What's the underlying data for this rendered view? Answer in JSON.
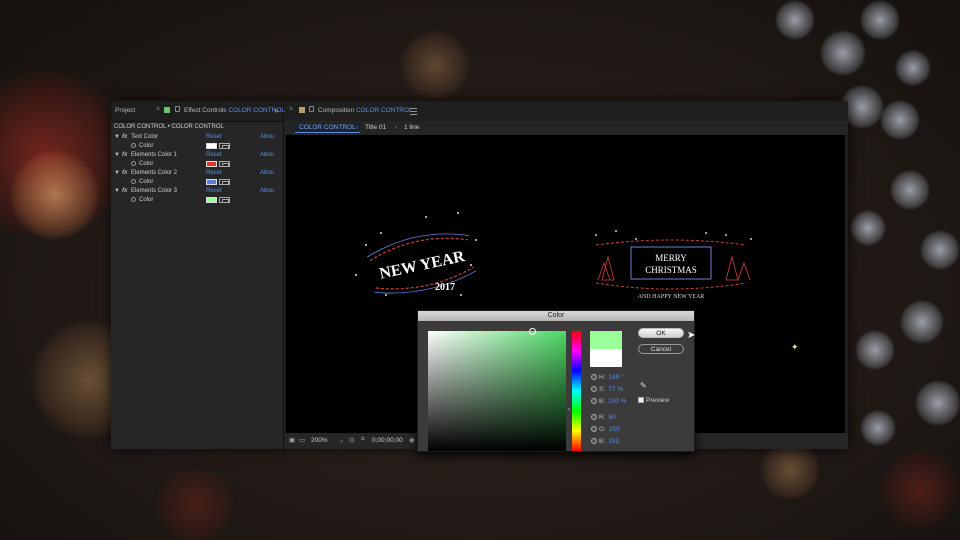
{
  "left_tabs": {
    "project": "Project",
    "effect_controls_prefix": "Effect Controls",
    "effect_controls_name": "COLOR CONTROL"
  },
  "effect_controls": {
    "header": "COLOR CONTROL • COLOR CONTROL",
    "reset": "Reset",
    "about": "Abou",
    "effects": [
      {
        "name": "Text Color",
        "prop": "Color",
        "swatch": "#ffffff"
      },
      {
        "name": "Elements Color 1",
        "prop": "Color",
        "swatch": "#e03030"
      },
      {
        "name": "Elements Color 2",
        "prop": "Color",
        "swatch": "#5f7fd6"
      },
      {
        "name": "Elements Color 3",
        "prop": "Color",
        "swatch": "#99ff99"
      }
    ]
  },
  "composition": {
    "tab_prefix": "Composition",
    "tab_name": "COLOR CONTROL",
    "breadcrumb": [
      "COLOR CONTROL",
      "Title 01",
      "1 line"
    ],
    "zoom": "200%",
    "timecode": "0;00;00;00"
  },
  "scene": {
    "new_year_line1": "NEW YEAR",
    "new_year_line2": "2017",
    "merry_line1": "MERRY",
    "merry_line2": "CHRISTMAS",
    "merry_line3": "AND HAPPY NEW YEAR"
  },
  "color_dialog": {
    "title": "Color",
    "ok": "OK",
    "cancel": "Cancel",
    "fields": [
      {
        "label": "H:",
        "value": "149 °"
      },
      {
        "label": "S:",
        "value": "77 %"
      },
      {
        "label": "B:",
        "value": "100 %"
      },
      {
        "label": "R:",
        "value": "60"
      },
      {
        "label": "G:",
        "value": "255"
      },
      {
        "label": "B:",
        "value": "153"
      }
    ],
    "preview_label": "Preview",
    "new_color": "#99ff99",
    "old_color": "#ffffff"
  },
  "icons": [
    "close-icon",
    "lock-icon",
    "menu-icon",
    "stopwatch-icon",
    "eyedropper-icon",
    "collapse-icon",
    "anchor-point-icon",
    "cursor-icon"
  ]
}
